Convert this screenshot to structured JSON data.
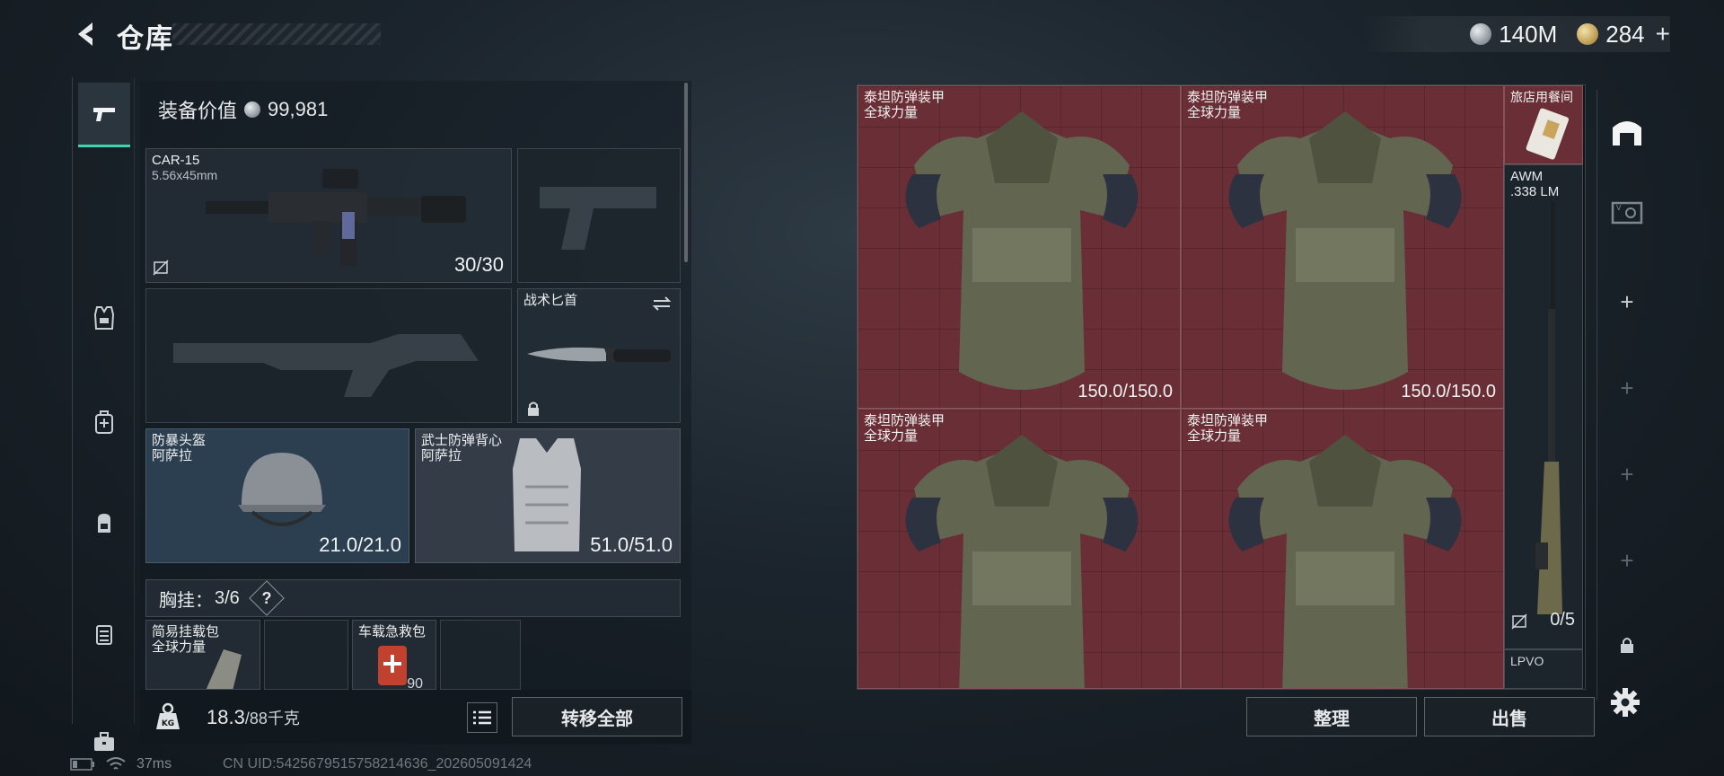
{
  "header": {
    "title": "仓库",
    "currencies": [
      {
        "icon": "silver-coin-icon",
        "amount": "140M"
      },
      {
        "icon": "gold-coin-icon",
        "amount": "284"
      }
    ],
    "add_label": "+"
  },
  "categories": [
    {
      "name": "weapons",
      "icon": "pistol-icon",
      "active": true
    },
    {
      "name": "armor",
      "icon": "vest-icon"
    },
    {
      "name": "medical",
      "icon": "medkit-bag-icon"
    },
    {
      "name": "backpacks",
      "icon": "backpack-icon"
    },
    {
      "name": "containers",
      "icon": "case-icon"
    },
    {
      "name": "toolbox",
      "icon": "toolbox-icon"
    }
  ],
  "loadout": {
    "equip_value_label": "装备价值",
    "equip_value": "99,981",
    "primary_weapon": {
      "name": "CAR-15",
      "caliber": "5.56x45mm",
      "ammo": "30/30"
    },
    "knife": {
      "name": "战术匕首"
    },
    "helmet": {
      "name": "防暴头盔",
      "brand": "阿萨拉",
      "durability": "21.0/21.0"
    },
    "vest": {
      "name": "武士防弹背心",
      "brand": "阿萨拉",
      "durability": "51.0/51.0"
    },
    "rig": {
      "label": "胸挂：",
      "count": "3/6",
      "help": "?"
    },
    "rig_items": [
      {
        "name": "简易挂载包",
        "brand": "全球力量"
      },
      {
        "name": ""
      },
      {
        "name": "车载急救包",
        "value": "90"
      },
      {
        "name": ""
      }
    ],
    "weight": {
      "current": "18.3",
      "max": "/88千克"
    },
    "transfer_all_label": "转移全部"
  },
  "status": {
    "ping": "37ms",
    "uid": "CN UID:5425679515758214636_202605091424"
  },
  "storage": {
    "items": [
      {
        "name": "泰坦防弹装甲",
        "brand": "全球力量",
        "durability": "150.0/150.0"
      },
      {
        "name": "泰坦防弹装甲",
        "brand": "全球力量",
        "durability": "150.0/150.0"
      },
      {
        "name": "泰坦防弹装甲",
        "brand": "全球力量",
        "durability": ""
      },
      {
        "name": "泰坦防弹装甲",
        "brand": "全球力量",
        "durability": ""
      }
    ],
    "side_items": [
      {
        "name": "旅店用餐间"
      },
      {
        "name": "AWM",
        "caliber": ".338 LM",
        "ammo": "0/5"
      },
      {
        "name": "LPVO"
      }
    ],
    "sort_label": "整理",
    "sell_label": "出售"
  },
  "side_tabs": [
    {
      "icon": "warehouse-icon",
      "active": true
    },
    {
      "icon": "v-card-icon"
    },
    {
      "icon": "add-icon",
      "label": "+"
    },
    {
      "icon": "add-icon",
      "label": "+"
    },
    {
      "icon": "add-icon",
      "label": "+"
    },
    {
      "icon": "add-icon",
      "label": "+"
    },
    {
      "icon": "lock-icon"
    }
  ],
  "colors": {
    "accent": "#3fd4b0",
    "storage_cell": "#6a2f36",
    "helmet_cell": "#2c3f50"
  }
}
